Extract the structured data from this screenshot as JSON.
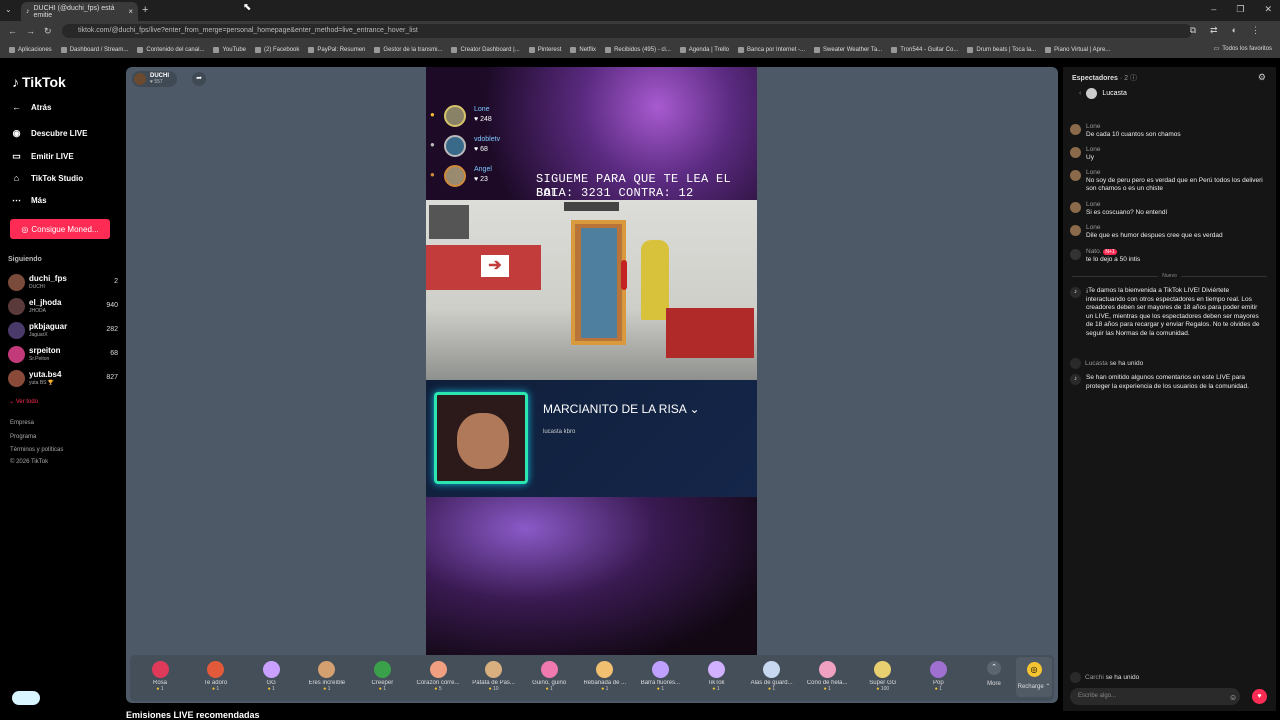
{
  "browser": {
    "tab_title": "DUCHI (@duchi_fps) está emitie",
    "tab_close": "×",
    "new_tab": "+",
    "url": "tiktok.com/@duchi_fps/live?enter_from_merge=personal_homepage&enter_method=live_entrance_hover_list",
    "bookmarks": [
      "Aplicaciones",
      "Dashboard / Stream...",
      "Contenido del canal...",
      "YouTube",
      "(2) Facebook",
      "PayPal: Resumen",
      "Gestor de la transmi...",
      "Creator Dashboard |...",
      "Pinterest",
      "Netflix",
      "Recibidos (495) - cl...",
      "Agenda | Trello",
      "Banca por Internet -...",
      "Sweater Weather Ta...",
      "Tron544 - Guitar Co...",
      "Drum beats | Toca la...",
      "Piano Virtual | Apre..."
    ],
    "bookmarks_all": "Todos los favoritos"
  },
  "sidebar": {
    "logo": "TikTok",
    "nav": [
      {
        "label": "Atrás",
        "icon": "back-arrow-icon"
      },
      {
        "label": "Descubre LIVE",
        "icon": "live-icon"
      },
      {
        "label": "Emitir LIVE",
        "icon": "camera-icon"
      },
      {
        "label": "TikTok Studio",
        "icon": "home-icon"
      },
      {
        "label": "Más",
        "icon": "more-dots-icon"
      }
    ],
    "coins_button": "Consigue Moned...",
    "following_header": "Siguiendo",
    "following": [
      {
        "name": "duchi_fps",
        "sub": "DUCHI",
        "count": "2"
      },
      {
        "name": "el_jhoda",
        "sub": "JHODA",
        "count": "940"
      },
      {
        "name": "pkbjaguar",
        "sub": "JaguarX",
        "count": "282"
      },
      {
        "name": "srpeiton",
        "sub": "Sr.Peiton",
        "count": "68"
      },
      {
        "name": "yuta.bs4",
        "sub": "yuta BS 🏆",
        "count": "827"
      }
    ],
    "see_all": "Ver todo",
    "footer": [
      "Empresa",
      "Programa",
      "Términos y políticas",
      "© 2026 TikTok"
    ]
  },
  "stream": {
    "streamer_name": "DUCHI",
    "streamer_likes": "557",
    "leaderboard": [
      {
        "name": "Lone",
        "score": "248"
      },
      {
        "name": "vdobletv",
        "score": "68"
      },
      {
        "name": "Angel",
        "score": "23"
      }
    ],
    "overlay_line1": "SIGUEME PARA QUE TE LEA EL BOT",
    "overlay_line2": "SALA: 3231 CONTRA: 12",
    "card_title": "MARCIANITO DE LA RISA",
    "card_subtitle": "lucasta kbro"
  },
  "gifts": [
    {
      "name": "Rosa",
      "price": "1",
      "color": "#e03a5a"
    },
    {
      "name": "Te adoro",
      "price": "1",
      "color": "#e25a3a"
    },
    {
      "name": "GG",
      "price": "1",
      "color": "#c9a0ff"
    },
    {
      "name": "Eres increíble",
      "price": "1",
      "color": "#d4a070"
    },
    {
      "name": "Creeper",
      "price": "1",
      "color": "#3aa04a"
    },
    {
      "name": "Corazón corre...",
      "price": "5",
      "color": "#f0a080"
    },
    {
      "name": "Patata de Pas...",
      "price": "10",
      "color": "#d8b080"
    },
    {
      "name": "Guiño, guiño",
      "price": "1",
      "color": "#f07ab0"
    },
    {
      "name": "Rebanada de ...",
      "price": "1",
      "color": "#f0c070"
    },
    {
      "name": "Barra fluores...",
      "price": "1",
      "color": "#c0a0ff"
    },
    {
      "name": "TikTok",
      "price": "1",
      "color": "#d0b0ff"
    },
    {
      "name": "Alas de guard...",
      "price": "1",
      "color": "#c8d8f0"
    },
    {
      "name": "Cono de hela...",
      "price": "1",
      "color": "#f0a0c0"
    },
    {
      "name": "Super GG",
      "price": "100",
      "color": "#e8d070"
    },
    {
      "name": "Pop",
      "price": "1",
      "color": "#a070d0"
    }
  ],
  "gift_more": "More",
  "gift_recharge": "Recharge",
  "recommended": "Emisiones LIVE recomendadas",
  "chat": {
    "header": "Espectadores",
    "viewer_count": "2",
    "viewer": "Lucasta",
    "messages": [
      {
        "user": "Lone",
        "text": "De cada 10 cuantos son chamos"
      },
      {
        "user": "Lone",
        "text": "Uy"
      },
      {
        "user": "Lone",
        "text": "No soy de peru pero es verdad que en Perú todos los deliveri son chamos o es un chiste"
      },
      {
        "user": "Lone",
        "text": "Si es coscuano? No entendí"
      },
      {
        "user": "Lone",
        "text": "Dile que es humor despues cree que es verdad"
      },
      {
        "user": "Nato.",
        "badge": "N+1",
        "text": "te lo dejo a 50 intis"
      }
    ],
    "new_divider": "Nuevo",
    "welcome": "¡Te damos la bienvenida a TikTok LIVE! Diviértete interactuando con otros espectadores en tiempo real. Los creadores deben ser mayores de 18 años para poder emitir un LIVE, mientras que los espectadores deben ser mayores de 18 años para recargar y enviar Regalos. No te olvides de seguir las Normas de la comunidad.",
    "joined1_user": "Lucasta",
    "joined_text": "se ha unido",
    "omitted": "Se han omitido algunos comentarios en este LIVE para proteger la experiencia de los usuarios de la comunidad.",
    "joined2_user": "Carchi",
    "input_placeholder": "Escribe algo..."
  }
}
